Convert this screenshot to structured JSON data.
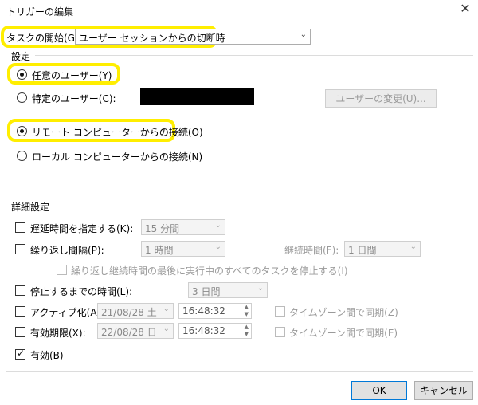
{
  "dialog": {
    "title": "トリガーの編集",
    "close_glyph": "✕"
  },
  "task_start": {
    "label": "タスクの開始(G):",
    "value": "ユーザー セッションからの切断時"
  },
  "settings": {
    "group_label": "設定",
    "any_user": "任意のユーザー(Y)",
    "specific_user": "特定のユーザー(C):",
    "change_user_button": "ユーザーの変更(U)...",
    "remote_connect": "リモート コンピューターからの接続(O)",
    "local_connect": "ローカル コンピューターからの接続(N)"
  },
  "advanced": {
    "group_label": "詳細設定",
    "delay_label": "遅延時間を指定する(K):",
    "delay_value": "15 分間",
    "repeat_label": "繰り返し間隔(P):",
    "repeat_value": "1 時間",
    "duration_label": "継続時間(F):",
    "duration_value": "1 日間",
    "stop_all_label": "繰り返し継続時間の最後に実行中のすべてのタスクを停止する(I)",
    "stop_after_label": "停止するまでの時間(L):",
    "stop_after_value": "3 日間",
    "activate_label": "アクティブ化(A):",
    "activate_date": "21/08/28 土",
    "activate_time": "16:48:32",
    "sync_tz_a": "タイムゾーン間で同期(Z)",
    "expire_label": "有効期限(X):",
    "expire_date": "22/08/28 日",
    "expire_time": "16:48:32",
    "sync_tz_e": "タイムゾーン間で同期(E)",
    "enabled_label": "有効(B)"
  },
  "buttons": {
    "ok": "OK",
    "cancel": "キャンセル"
  },
  "colors": {
    "highlight": "#ffee00",
    "ok_border": "#0078d7"
  }
}
